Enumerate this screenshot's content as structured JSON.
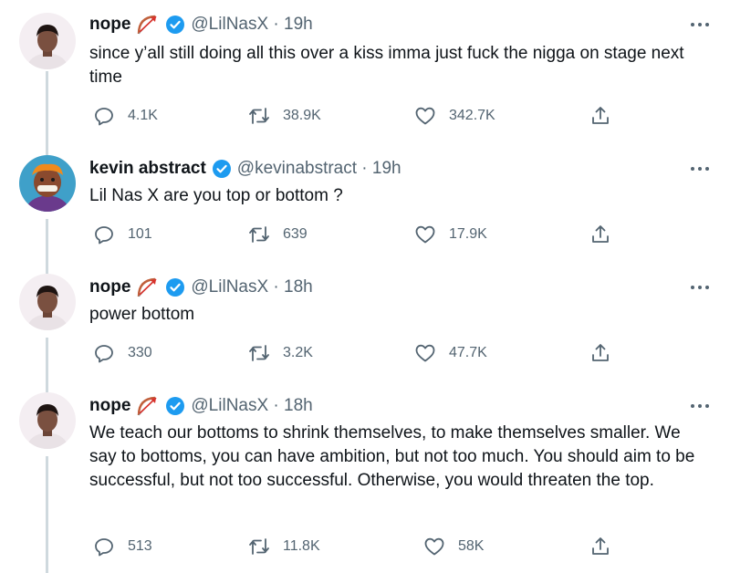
{
  "tweets": [
    {
      "name": "nope",
      "handle": "@LilNasX · 19h",
      "has_emoji": true,
      "text": "since y’all still doing all this over a kiss imma just fuck the nigga on stage next time",
      "replies": "4.1K",
      "retweets": "38.9K",
      "likes": "342.7K"
    },
    {
      "name": "kevin abstract",
      "handle": "@kevinabstract · 19h",
      "has_emoji": false,
      "text": "Lil Nas X are you top or bottom ?",
      "replies": "101",
      "retweets": "639",
      "likes": "17.9K"
    },
    {
      "name": "nope",
      "handle": "@LilNasX · 18h",
      "has_emoji": true,
      "text": "power bottom",
      "replies": "330",
      "retweets": "3.2K",
      "likes": "47.7K"
    },
    {
      "name": "nope",
      "handle": "@LilNasX · 18h",
      "has_emoji": true,
      "text": "We teach our bottoms to shrink themselves, to make themselves smaller. We say to bottoms, you can have ambition, but not too much. You should aim to be successful, but not too successful. Otherwise, you would threaten the top.",
      "replies": "513",
      "retweets": "11.8K",
      "likes": "58K"
    }
  ],
  "icons": {
    "reply": "reply-icon",
    "retweet": "retweet-icon",
    "like": "heart-icon",
    "share": "share-icon",
    "verified": "verified-badge-icon",
    "more": "more-dots-icon",
    "emoji": "bow-and-arrow-emoji"
  },
  "colors": {
    "text": "#0f1419",
    "secondary": "#536471",
    "verified": "#1d9bf0",
    "thread_line": "#cfd9de"
  }
}
